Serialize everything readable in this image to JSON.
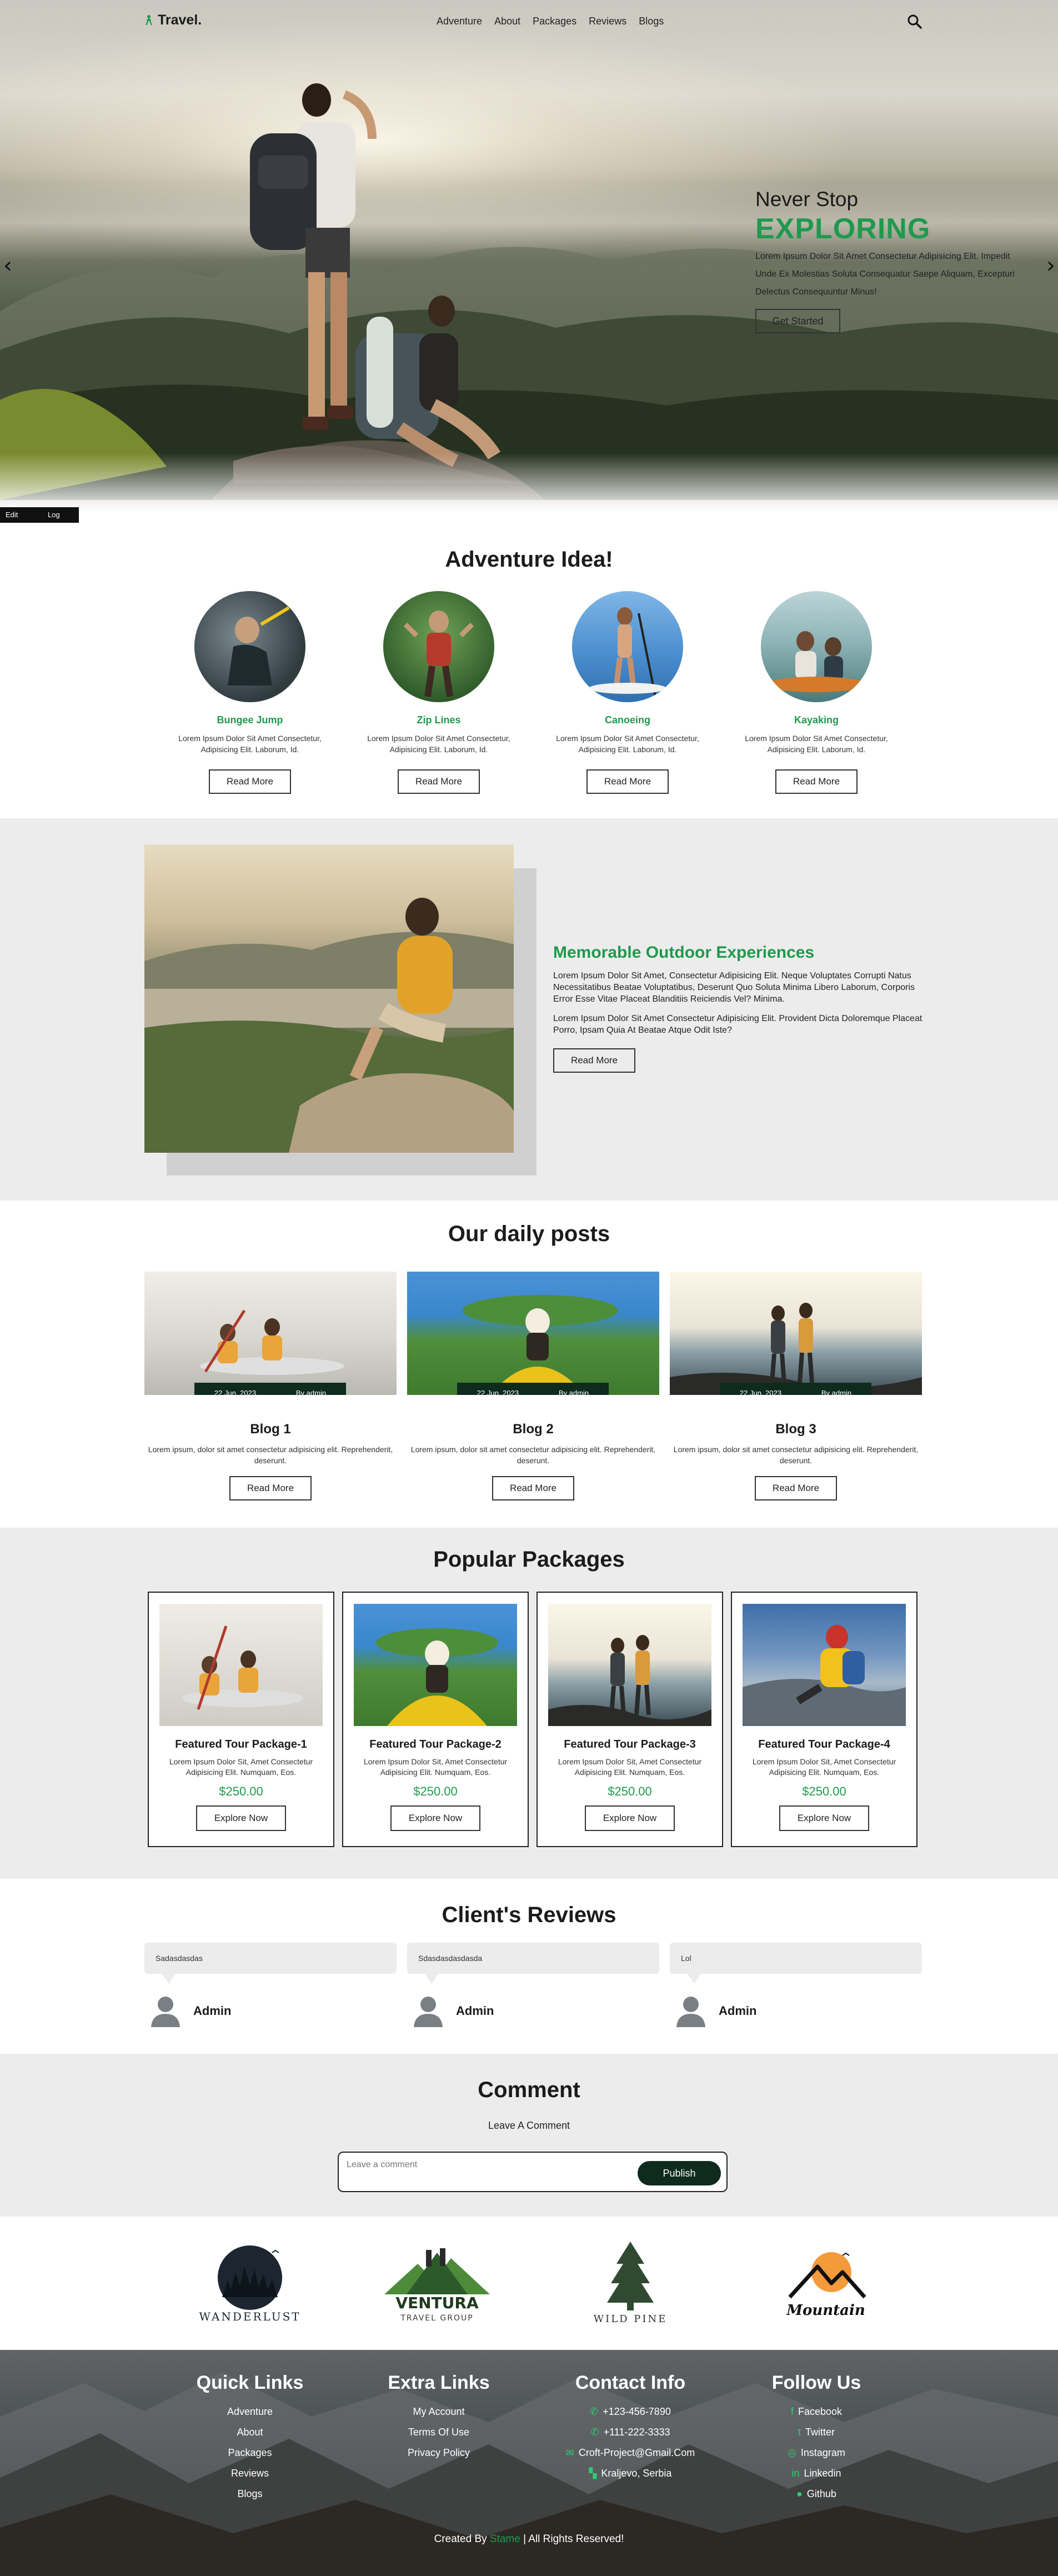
{
  "nav": {
    "logo": "Travel.",
    "links": [
      "Adventure",
      "About",
      "Packages",
      "Reviews",
      "Blogs"
    ]
  },
  "hero": {
    "line1": "Never Stop",
    "line2": "EXPLORING",
    "text": "Lorem Ipsum Dolor Sit Amet Consectetur Adipisicing Elit. Impedit Unde Ex Molestias Soluta Consequatur Saepe Aliquam, Excepturi Delectus Consequuntur Minus!",
    "button": "Get Started",
    "prev": "‹",
    "next": "›"
  },
  "admin_bar": {
    "edit": "Edit Page",
    "logout": "Log Out"
  },
  "ideas": {
    "title": "Adventure Idea!",
    "items": [
      {
        "name": "Bungee Jump",
        "desc": "Lorem Ipsum Dolor Sit Amet Consectetur, Adipisicing Elit. Laborum, Id.",
        "button": "Read More"
      },
      {
        "name": "Zip Lines",
        "desc": "Lorem Ipsum Dolor Sit Amet Consectetur, Adipisicing Elit. Laborum, Id.",
        "button": "Read More"
      },
      {
        "name": "Canoeing",
        "desc": "Lorem Ipsum Dolor Sit Amet Consectetur, Adipisicing Elit. Laborum, Id.",
        "button": "Read More"
      },
      {
        "name": "Kayaking",
        "desc": "Lorem Ipsum Dolor Sit Amet Consectetur, Adipisicing Elit. Laborum, Id.",
        "button": "Read More"
      }
    ]
  },
  "memorable": {
    "title": "Memorable Outdoor Experiences",
    "p1": "Lorem Ipsum Dolor Sit Amet, Consectetur Adipisicing Elit. Neque Voluptates Corrupti Natus Necessitatibus Beatae Voluptatibus, Deserunt Quo Soluta Minima Libero Laborum, Corporis Error Esse Vitae Placeat Blanditiis Reiciendis Vel? Minima.",
    "p2": "Lorem Ipsum Dolor Sit Amet Consectetur Adipisicing Elit. Provident Dicta Doloremque Placeat Porro, Ipsam Quia At Beatae Atque Odit Iste?",
    "button": "Read More"
  },
  "blog": {
    "title": "Our daily posts",
    "posts": [
      {
        "date": "22 Jun, 2023",
        "author": "By admin",
        "title": "Blog 1",
        "text": "Lorem ipsum, dolor sit amet consectetur adipisicing elit. Reprehenderit, deserunt.",
        "button": "Read More"
      },
      {
        "date": "22 Jun, 2023",
        "author": "By admin",
        "title": "Blog 2",
        "text": "Lorem ipsum, dolor sit amet consectetur adipisicing elit. Reprehenderit, deserunt.",
        "button": "Read More"
      },
      {
        "date": "22 Jun, 2023",
        "author": "By admin",
        "title": "Blog 3",
        "text": "Lorem ipsum, dolor sit amet consectetur adipisicing elit. Reprehenderit, deserunt.",
        "button": "Read More"
      }
    ]
  },
  "packages": {
    "title": "Popular Packages",
    "items": [
      {
        "title": "Featured Tour Package-1",
        "desc": "Lorem Ipsum Dolor Sit, Amet Consectetur Adipisicing Elit. Numquam, Eos.",
        "price": "$250.00",
        "button": "Explore Now"
      },
      {
        "title": "Featured Tour Package-2",
        "desc": "Lorem Ipsum Dolor Sit, Amet Consectetur Adipisicing Elit. Numquam, Eos.",
        "price": "$250.00",
        "button": "Explore Now"
      },
      {
        "title": "Featured Tour Package-3",
        "desc": "Lorem Ipsum Dolor Sit, Amet Consectetur Adipisicing Elit. Numquam, Eos.",
        "price": "$250.00",
        "button": "Explore Now"
      },
      {
        "title": "Featured Tour Package-4",
        "desc": "Lorem Ipsum Dolor Sit, Amet Consectetur Adipisicing Elit. Numquam, Eos.",
        "price": "$250.00",
        "button": "Explore Now"
      }
    ]
  },
  "reviews": {
    "title": "Client's Reviews",
    "items": [
      {
        "text": "Sadasdasdas",
        "user": "Admin"
      },
      {
        "text": "Sdasdasdasdasda",
        "user": "Admin"
      },
      {
        "text": "Lol",
        "user": "Admin"
      }
    ]
  },
  "comment": {
    "title": "Comment",
    "subtitle": "Leave A Comment",
    "placeholder": "Leave a comment",
    "button": "Publish"
  },
  "partners": {
    "wanderlust": "WANDERLUST",
    "ventura": "VENTURA",
    "ventura_sub": "TRAVEL GROUP",
    "wildpine": "WILD PINE",
    "mountain": "Mountain"
  },
  "footer": {
    "quick": {
      "title": "Quick Links",
      "links": [
        "Adventure",
        "About",
        "Packages",
        "Reviews",
        "Blogs"
      ]
    },
    "extra": {
      "title": "Extra Links",
      "links": [
        "My Account",
        "Terms Of Use",
        "Privacy Policy"
      ]
    },
    "contact": {
      "title": "Contact Info",
      "items": [
        "+123-456-7890",
        "+111-222-3333",
        "Croft-Project@Gmail.Com",
        "Kraljevo, Serbia"
      ]
    },
    "follow": {
      "title": "Follow Us",
      "links": [
        "Facebook",
        "Twitter",
        "Instagram",
        "Linkedin",
        "Github"
      ]
    },
    "credit_pre": "Created By",
    "credit_name": "Stame",
    "credit_post": "| All Rights Reserved!"
  },
  "colors": {
    "accent": "#1f9a4d",
    "dark": "#0f2a1e",
    "section_gray": "#ececec"
  }
}
